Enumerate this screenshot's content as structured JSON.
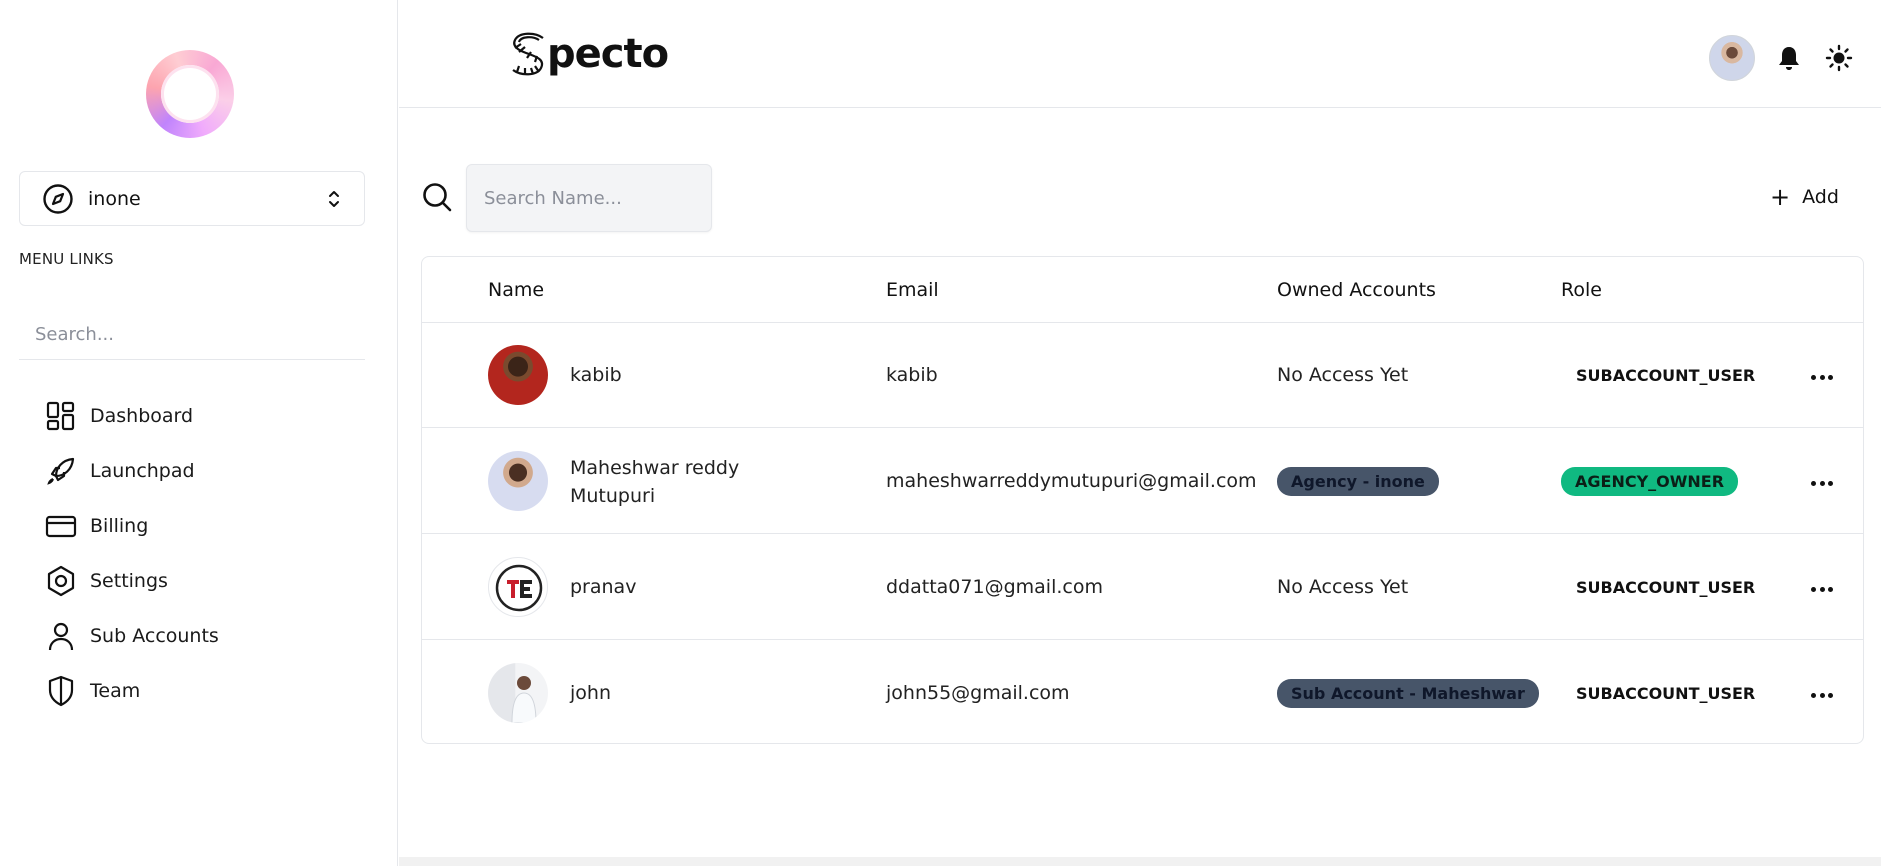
{
  "brand": {
    "name": "pecto"
  },
  "sidebar": {
    "account": {
      "name": "inone"
    },
    "menu_title": "MENU LINKS",
    "search_placeholder": "Search...",
    "items": [
      {
        "label": "Dashboard",
        "icon": "dashboard-icon"
      },
      {
        "label": "Launchpad",
        "icon": "rocket-icon"
      },
      {
        "label": "Billing",
        "icon": "credit-card-icon"
      },
      {
        "label": "Settings",
        "icon": "hexagon-settings-icon"
      },
      {
        "label": "Sub Accounts",
        "icon": "user-icon"
      },
      {
        "label": "Team",
        "icon": "shield-icon"
      }
    ]
  },
  "toolbar": {
    "search_placeholder": "Search Name...",
    "add_label": "Add"
  },
  "table": {
    "columns": [
      "Name",
      "Email",
      "Owned Accounts",
      "Role"
    ],
    "rows": [
      {
        "name": "kabib",
        "email": "kabib",
        "owned": "No Access Yet",
        "owned_is_badge": false,
        "role": "SUBACCOUNT_USER",
        "role_style": "plain"
      },
      {
        "name": "Maheshwar reddy Mutupuri",
        "email": "maheshwarreddymutupuri@gmail.com",
        "owned": "Agency - inone",
        "owned_is_badge": true,
        "role": "AGENCY_OWNER",
        "role_style": "green"
      },
      {
        "name": "pranav",
        "email": "ddatta071@gmail.com",
        "owned": "No Access Yet",
        "owned_is_badge": false,
        "role": "SUBACCOUNT_USER",
        "role_style": "plain"
      },
      {
        "name": "john",
        "email": "john55@gmail.com",
        "owned": "Sub Account - Maheshwar",
        "owned_is_badge": true,
        "role": "SUBACCOUNT_USER",
        "role_style": "plain"
      }
    ]
  },
  "colors": {
    "border": "#e5e7eb",
    "badge_dark": "#475569",
    "badge_green": "#10b981"
  }
}
